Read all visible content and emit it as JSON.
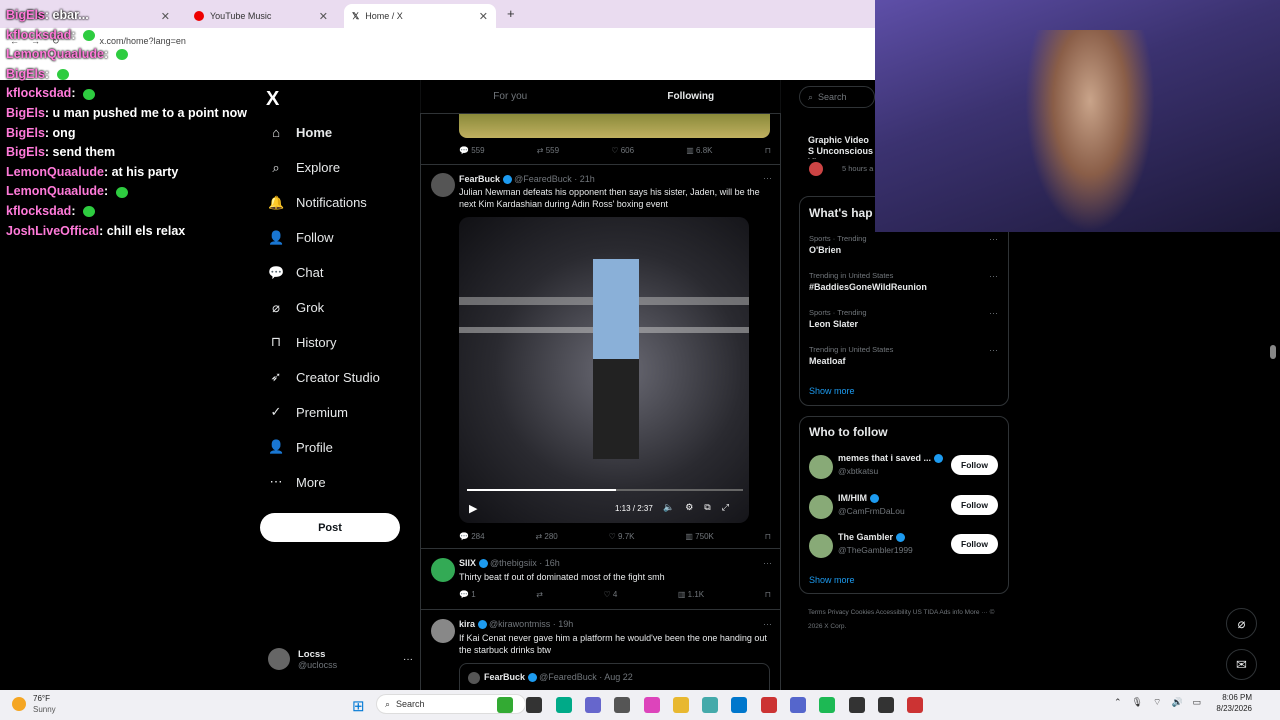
{
  "browser": {
    "tabs": [
      {
        "label": "St"
      },
      {
        "label": "YouTube Music"
      },
      {
        "label": "Home / X"
      }
    ],
    "new_tab": "+",
    "url": "x.com/home?lang=en"
  },
  "chat": [
    {
      "user": "BigEls",
      "msg": "ebar..."
    },
    {
      "user": "kflocksdad",
      "msg": ""
    },
    {
      "user": "LemonQuaalude",
      "msg": ""
    },
    {
      "user": "BigEls",
      "msg": ""
    },
    {
      "user": "kflocksdad",
      "msg": ""
    },
    {
      "user": "BigEls",
      "msg": "u man pushed me to a point now"
    },
    {
      "user": "BigEls",
      "msg": "ong"
    },
    {
      "user": "BigEls",
      "msg": "send them"
    },
    {
      "user": "LemonQuaalude",
      "msg": "at his party"
    },
    {
      "user": "LemonQuaalude",
      "msg": ""
    },
    {
      "user": "kflocksdad",
      "msg": ""
    },
    {
      "user": "JoshLiveOffical",
      "msg": "chill els relax"
    }
  ],
  "nav": {
    "logo": "X",
    "items": [
      {
        "label": "Home",
        "icon": "home-icon"
      },
      {
        "label": "Explore",
        "icon": "search-icon"
      },
      {
        "label": "Notifications",
        "icon": "bell-icon"
      },
      {
        "label": "Follow",
        "icon": "add-user-icon"
      },
      {
        "label": "Chat",
        "icon": "chat-icon"
      },
      {
        "label": "Grok",
        "icon": "grok-icon"
      },
      {
        "label": "History",
        "icon": "bookmark-icon"
      },
      {
        "label": "Creator Studio",
        "icon": "rocket-icon"
      },
      {
        "label": "Premium",
        "icon": "verified-icon"
      },
      {
        "label": "Profile",
        "icon": "person-icon"
      },
      {
        "label": "More",
        "icon": "more-icon"
      }
    ],
    "post": "Post",
    "profile": {
      "name": "Locss",
      "handle": "@uclocss",
      "more": "···"
    }
  },
  "feed": {
    "tabs": [
      "For you",
      "Following"
    ],
    "top_actions": {
      "replies": "559",
      "reposts": "559",
      "likes": "606",
      "views": "6.8K"
    },
    "tweets": [
      {
        "name": "FearBuck",
        "handle": "@FearedBuck · 21h",
        "text": "Julian Newman defeats his opponent then says his sister, Jaden, will be the next Kim Kardashian during Adin Ross' boxing event",
        "video_time": "1:13 / 2:37",
        "replies": "284",
        "reposts": "280",
        "likes": "9.7K",
        "views": "750K"
      },
      {
        "name": "SIIX",
        "handle": "@thebigsiix · 16h",
        "text": "Thirty beat tf out of dominated most of the fight smh",
        "replies": "1",
        "reposts": "",
        "likes": "4",
        "views": "1.1K"
      },
      {
        "name": "kira",
        "handle": "@kirawontmiss · 19h",
        "text": "If Kai Cenat never gave him a platform he would've been the one handing out the starbuck drinks btw",
        "quote_name": "FearBuck",
        "quote_handle": "@FearedBuck · Aug 22"
      }
    ]
  },
  "sidebar": {
    "search_placeholder": "Search",
    "news": {
      "title": "Graphic Video S Unconscious Vi",
      "meta": "5 hours a"
    },
    "trends_title": "What's hap",
    "trends": [
      {
        "meta": "Sports · Trending",
        "name": "O'Brien"
      },
      {
        "meta": "Trending in United States",
        "name": "#BaddiesGoneWildReunion"
      },
      {
        "meta": "Sports · Trending",
        "name": "Leon Slater"
      },
      {
        "meta": "Trending in United States",
        "name": "Meatloaf"
      }
    ],
    "show_more": "Show more",
    "who_title": "Who to follow",
    "who": [
      {
        "name": "memes that i saved ...",
        "handle": "@xbtkatsu",
        "btn": "Follow"
      },
      {
        "name": "IM/HIM",
        "handle": "@CamFrmDaLou",
        "btn": "Follow"
      },
      {
        "name": "The Gambler",
        "handle": "@TheGambler1999",
        "btn": "Follow"
      }
    ],
    "who_show_more": "Show more",
    "footer": "Terms   Privacy   Cookies   Accessibility   US TIDA   Ads info   More ···   © 2026 X Corp."
  },
  "taskbar": {
    "weather_temp": "76°F",
    "weather_desc": "Sunny",
    "search": "Search",
    "time": "8:06 PM",
    "date": "8/23/2026"
  }
}
